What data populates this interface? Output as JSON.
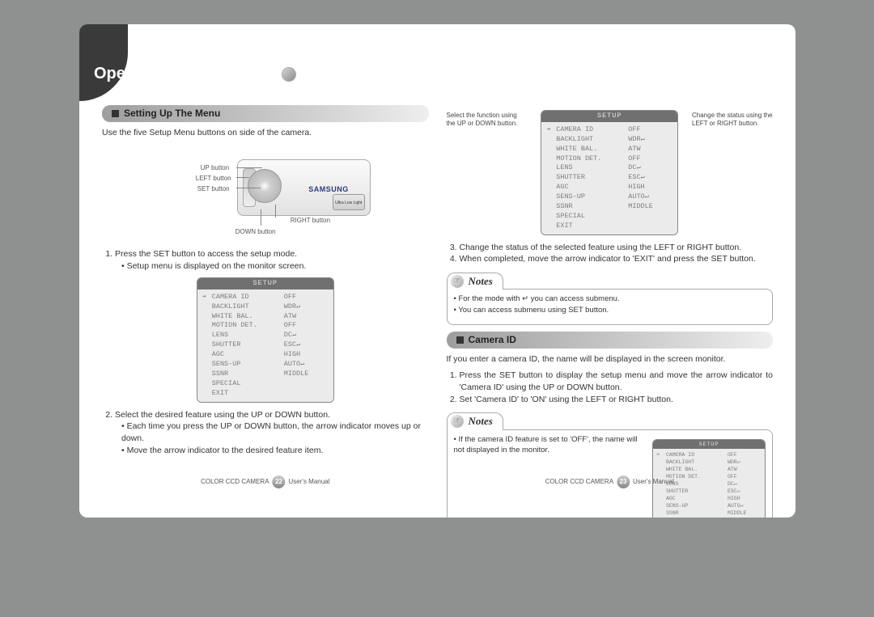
{
  "title": "Operating Your Camera",
  "sections": {
    "setup_menu": {
      "heading": "Setting Up The Menu",
      "intro": "Use the five Setup Menu buttons on side of the camera.",
      "button_labels": {
        "up": "UP button",
        "left": "LEFT button",
        "set": "SET button",
        "down": "DOWN button",
        "right": "RIGHT button"
      },
      "brand": "SAMSUNG",
      "badge": "Ultra Low Light",
      "step1": "Press the SET button to access the setup mode.",
      "step1_bullet": "Setup menu is displayed on the monitor screen.",
      "step2": "Select the desired feature using the UP or DOWN button.",
      "step2_bullets": [
        "Each time you press the UP or DOWN button, the arrow indicator moves up or down.",
        "Move the arrow indicator to the desired feature item."
      ],
      "step3": "Change the status of the selected feature using the LEFT or RIGHT button.",
      "step4": "When completed, move the arrow indicator to 'EXIT' and press the SET button.",
      "annot_left": "Select the function using the UP or DOWN button.",
      "annot_right": "Change the status using the LEFT or RIGHT button."
    },
    "camera_id": {
      "heading": "Camera ID",
      "intro": "If you enter a camera ID, the name will be displayed in the screen monitor.",
      "step1": "Press the SET button to display the setup menu and move the arrow indicator to 'Camera ID' using the UP or DOWN button.",
      "step2": "Set 'Camera ID' to 'ON' using the LEFT or RIGHT button."
    }
  },
  "notes": {
    "label": "Notes",
    "box1": [
      "For the mode with ↵ you can access submenu.",
      "You can access submenu using SET button."
    ],
    "box2": [
      "If the camera ID feature is set to 'OFF', the name will not displayed in the monitor."
    ]
  },
  "osd": {
    "header": "SETUP",
    "rows": [
      {
        "label": "CAMERA ID",
        "val": "OFF",
        "sel": true
      },
      {
        "label": "BACKLIGHT",
        "val": "WDR↵"
      },
      {
        "label": "WHITE BAL.",
        "val": "ATW"
      },
      {
        "label": "MOTION DET.",
        "val": "OFF"
      },
      {
        "label": "LENS",
        "val": "DC↵"
      },
      {
        "label": "SHUTTER",
        "val": "ESC↵"
      },
      {
        "label": "AGC",
        "val": "HIGH"
      },
      {
        "label": "SENS-UP",
        "val": "AUTO↵"
      },
      {
        "label": "SSNR",
        "val": "MIDDLE"
      },
      {
        "label": "SPECIAL",
        "val": ""
      },
      {
        "label": "EXIT",
        "val": ""
      }
    ]
  },
  "footer": {
    "product": "COLOR CCD CAMERA",
    "suffix": "User's Manual",
    "page_left": "22",
    "page_right": "23"
  }
}
